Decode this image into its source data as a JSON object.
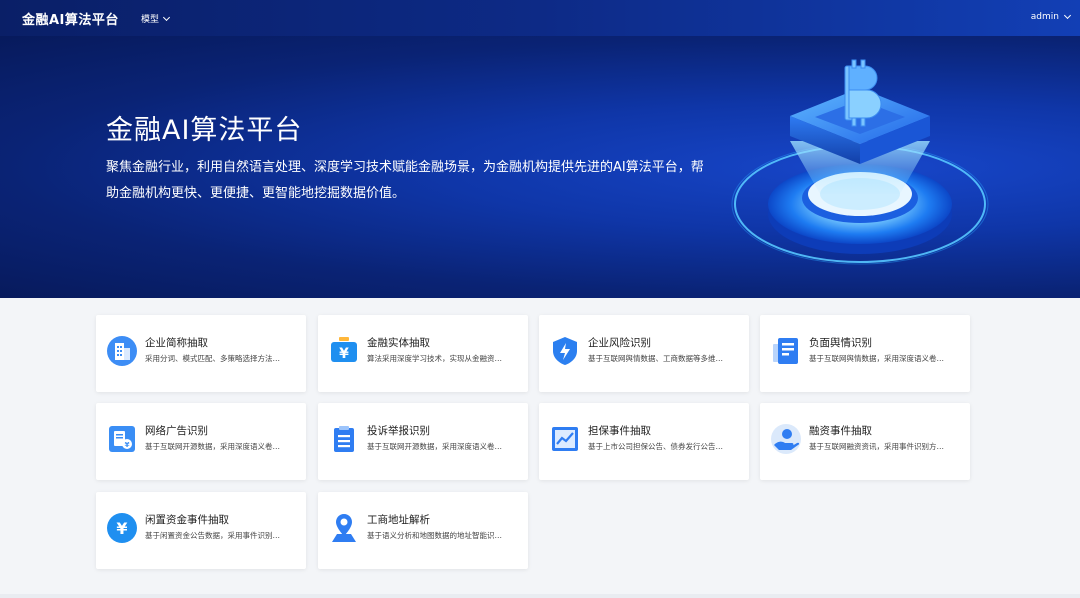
{
  "nav": {
    "brand": "金融AI算法平台",
    "menu_label": "模型",
    "user_label": "admin"
  },
  "hero": {
    "title": "金融AI算法平台",
    "description": "聚焦金融行业，利用自然语言处理、深度学习技术赋能金融场景，为金融机构提供先进的AI算法平台，帮助金融机构更快、更便捷、更智能地挖掘数据价值。"
  },
  "cards": [
    {
      "title": "企业简称抽取",
      "desc": "采用分词、模式匹配、多策略选择方法…",
      "icon": "building-icon"
    },
    {
      "title": "金融实体抽取",
      "desc": "算法采用深度学习技术，实现从金融资…",
      "icon": "yen-box-icon"
    },
    {
      "title": "企业风险识别",
      "desc": "基于互联网舆情数据、工商数据等多维…",
      "icon": "shield-bolt-icon"
    },
    {
      "title": "负面舆情识别",
      "desc": "基于互联网舆情数据，采用深度语义卷…",
      "icon": "document-icon"
    },
    {
      "title": "网络广告识别",
      "desc": "基于互联网开源数据，采用深度语义卷…",
      "icon": "ad-document-icon"
    },
    {
      "title": "投诉举报识别",
      "desc": "基于互联网开源数据，采用深度语义卷…",
      "icon": "clipboard-icon"
    },
    {
      "title": "担保事件抽取",
      "desc": "基于上市公司担保公告、债券发行公告…",
      "icon": "chart-frame-icon"
    },
    {
      "title": "融资事件抽取",
      "desc": "基于互联网融资资讯，采用事件识别方…",
      "icon": "hand-coin-icon"
    },
    {
      "title": "闲置资金事件抽取",
      "desc": "基于闲置资金公告数据，采用事件识别…",
      "icon": "yen-circle-icon"
    },
    {
      "title": "工商地址解析",
      "desc": "基于语义分析和地图数据的地址智能识…",
      "icon": "location-pin-icon"
    }
  ]
}
